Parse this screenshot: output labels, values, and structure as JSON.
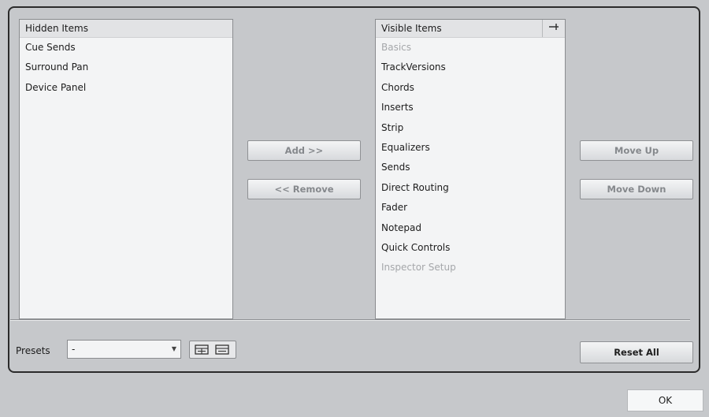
{
  "hidden_list": {
    "header": "Hidden Items",
    "items": [
      "Cue Sends",
      "Surround Pan",
      "Device Panel"
    ]
  },
  "visible_list": {
    "header": "Visible Items",
    "pin_glyph": "⊣",
    "items": [
      {
        "label": "Basics",
        "disabled": true
      },
      {
        "label": "TrackVersions",
        "disabled": false
      },
      {
        "label": "Chords",
        "disabled": false
      },
      {
        "label": "Inserts",
        "disabled": false
      },
      {
        "label": "Strip",
        "disabled": false
      },
      {
        "label": "Equalizers",
        "disabled": false
      },
      {
        "label": "Sends",
        "disabled": false
      },
      {
        "label": "Direct Routing",
        "disabled": false
      },
      {
        "label": "Fader",
        "disabled": false
      },
      {
        "label": "Notepad",
        "disabled": false
      },
      {
        "label": "Quick Controls",
        "disabled": false
      },
      {
        "label": "Inspector Setup",
        "disabled": true
      }
    ]
  },
  "buttons": {
    "add": "Add >>",
    "remove": "<< Remove",
    "move_up": "Move Up",
    "move_down": "Move Down",
    "reset_all": "Reset All",
    "ok": "OK"
  },
  "presets": {
    "label": "Presets",
    "selected": "-",
    "icons": [
      "save-preset-icon",
      "remove-preset-icon"
    ]
  }
}
